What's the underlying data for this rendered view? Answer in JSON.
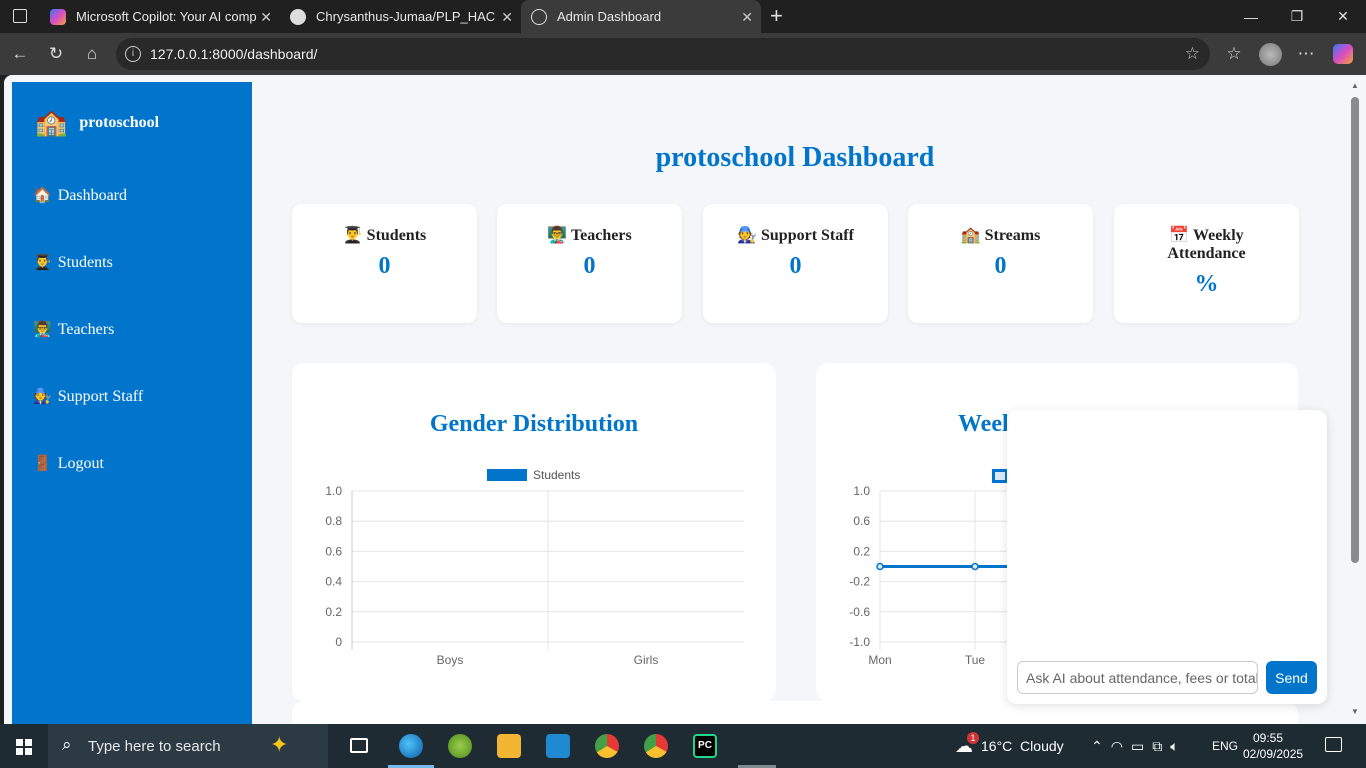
{
  "browser": {
    "tabs": [
      {
        "label": "Microsoft Copilot: Your AI companion",
        "icon": "copilot-icon"
      },
      {
        "label": "Chrysanthus-Jumaa/PLP_HACKATHON",
        "icon": "github-icon"
      },
      {
        "label": "Admin Dashboard",
        "icon": "globe-icon",
        "active": true
      }
    ],
    "url": "127.0.0.1:8000/dashboard/"
  },
  "sidebar": {
    "brand_emoji": "🏫",
    "brand": "protoschool",
    "items": [
      {
        "emoji": "🏠",
        "label": "Dashboard"
      },
      {
        "emoji": "👨‍🎓",
        "label": "Students"
      },
      {
        "emoji": "👨‍🏫",
        "label": "Teachers"
      },
      {
        "emoji": "🧑‍🔧",
        "label": "Support Staff"
      },
      {
        "emoji": "🚪",
        "label": "Logout"
      }
    ]
  },
  "dashboard": {
    "title": "protoschool Dashboard",
    "cards": [
      {
        "emoji": "👨‍🎓",
        "label": "Students",
        "value": "0"
      },
      {
        "emoji": "👨‍🏫",
        "label": "Teachers",
        "value": "0"
      },
      {
        "emoji": "🧑‍🔧",
        "label": "Support Staff",
        "value": "0"
      },
      {
        "emoji": "🏫",
        "label": "Streams",
        "value": "0"
      },
      {
        "emoji": "📅",
        "label": "Weekly Attendance",
        "value": "%"
      }
    ]
  },
  "chart_data": [
    {
      "type": "bar",
      "title": "Gender Distribution",
      "categories": [
        "Boys",
        "Girls"
      ],
      "series": [
        {
          "name": "Students",
          "values": [
            0,
            0
          ]
        }
      ],
      "yticks": [
        "1.0",
        "0.8",
        "0.6",
        "0.4",
        "0.2",
        "0"
      ],
      "ylim": [
        0,
        1.0
      ],
      "legend": "top"
    },
    {
      "type": "line",
      "title": "Weekly Attendance",
      "visible_title": "Weel",
      "categories": [
        "Mon",
        "Tue"
      ],
      "series": [
        {
          "name": "",
          "values": [
            0,
            0
          ]
        }
      ],
      "yticks": [
        "1.0",
        "0.6",
        "0.2",
        "-0.2",
        "-0.6",
        "-1.0"
      ],
      "ylim": [
        -1.0,
        1.0
      ],
      "legend": "top"
    }
  ],
  "chat": {
    "placeholder": "Ask AI about attendance, fees or totals",
    "send_label": "Send"
  },
  "taskbar": {
    "search_placeholder": "Type here to search",
    "weather": "16°C  Cloudy",
    "language": "ENG",
    "time": "09:55",
    "date": "02/09/2025",
    "weather_badge": "1"
  },
  "colors": {
    "accent": "#0175cc",
    "page_bg": "#f4f6f9"
  }
}
